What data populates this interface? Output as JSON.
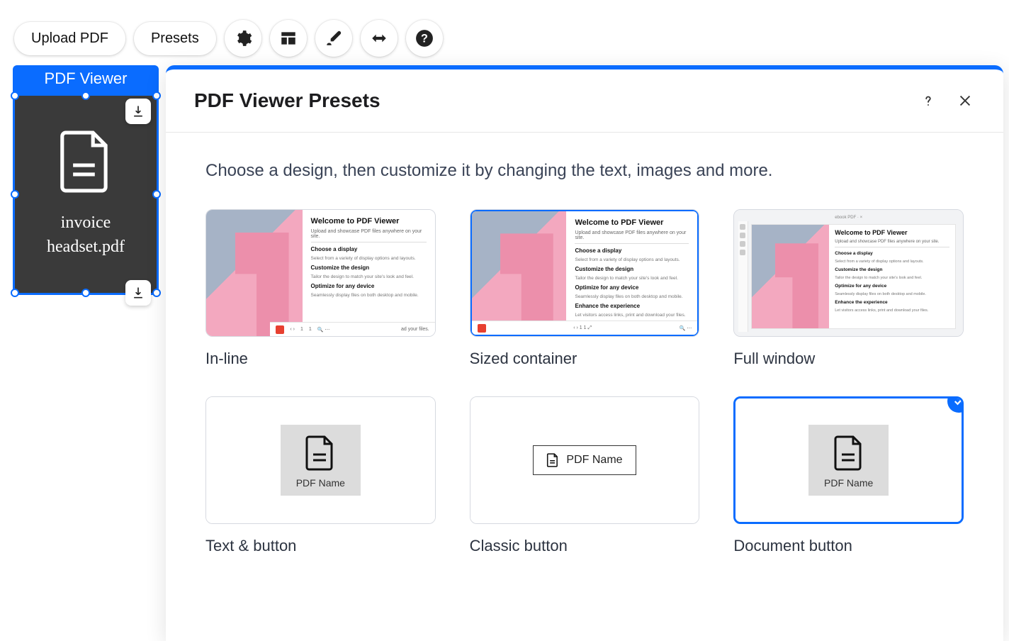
{
  "toolbar": {
    "upload_label": "Upload PDF",
    "presets_label": "Presets"
  },
  "widget": {
    "label": "PDF Viewer",
    "filename_line1": "invoice",
    "filename_line2": "headset.pdf"
  },
  "modal": {
    "title": "PDF Viewer Presets",
    "subheading": "Choose a design, then customize it by changing the text, images and more.",
    "preview": {
      "title": "Welcome to PDF Viewer",
      "subtitle": "Upload and showcase PDF files anywhere on your site.",
      "sections": [
        {
          "h": "Choose a display",
          "p": "Select from a variety of display options and layouts."
        },
        {
          "h": "Customize the design",
          "p": "Tailor the design to match your site's look and feel."
        },
        {
          "h": "Optimize for any device",
          "p": "Seamlessly display files on both desktop and mobile."
        },
        {
          "h": "Enhance the experience",
          "p": "Let visitors access links, print and download your files."
        }
      ],
      "page_num": "1",
      "page_total": "1",
      "bar_tail": "ad your files."
    },
    "presets": [
      {
        "key": "inline",
        "label": "In-line",
        "selected": false
      },
      {
        "key": "sized",
        "label": "Sized container",
        "selected": false
      },
      {
        "key": "full",
        "label": "Full window",
        "selected": false
      },
      {
        "key": "textbtn",
        "label": "Text & button",
        "selected": false
      },
      {
        "key": "classic",
        "label": "Classic button",
        "selected": false
      },
      {
        "key": "docbtn",
        "label": "Document button",
        "selected": true
      }
    ],
    "pdf_name_placeholder": "PDF Name"
  }
}
